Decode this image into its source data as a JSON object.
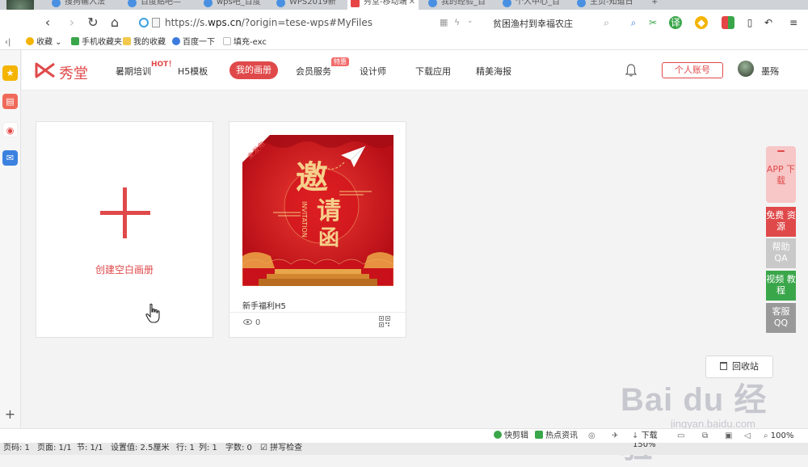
{
  "browser": {
    "tabs": [
      {
        "label": "搜狗输入法"
      },
      {
        "label": "百度贴吧—"
      },
      {
        "label": "wps吧_百度"
      },
      {
        "label": "WPS2019新"
      },
      {
        "label": "秀堂-移动端",
        "active": true
      },
      {
        "label": "我的经验_百"
      },
      {
        "label": "个人中心_百"
      },
      {
        "label": "主页-知道日"
      }
    ],
    "url_prefix": "https://s.",
    "url_host": "wps.cn",
    "url_rest": "/?origin=tese-wps#MyFiles",
    "search_text": "贫困渔村到幸福农庄"
  },
  "bookmarks": [
    {
      "label": "收藏",
      "color": "#f4b400"
    },
    {
      "label": "手机收藏夹",
      "color": "#3aa64a"
    },
    {
      "label": "我的收藏",
      "color": "#f2c94c"
    },
    {
      "label": "百度一下",
      "color": "#3b7be0"
    },
    {
      "label": "填充-exc",
      "color": "#cccccc"
    }
  ],
  "header": {
    "logo_text": "秀堂",
    "nav": {
      "summer": "暑期培训",
      "hot_badge": "HOT！",
      "h5": "H5模板",
      "albums": "我的画册",
      "member": "会员服务",
      "member_tag": "特惠",
      "designer": "设计师",
      "download": "下载应用",
      "poster": "精美海报"
    },
    "account_button": "个人账号",
    "user_name": "墨殇"
  },
  "content": {
    "create_label": "创建空白画册",
    "album": {
      "title": "新手福利H5",
      "views": "0",
      "status_ribbon": "未发布",
      "cover_text": [
        "邀",
        "请",
        "函"
      ],
      "cover_sub": "INVITATION"
    }
  },
  "float_panel": {
    "app": "APP 下载",
    "free": "免费 资源",
    "help": "帮助 QA",
    "video": "视频 教程",
    "qq": "客服 QQ"
  },
  "recycle_label": "回收站",
  "watermark": {
    "line1": "Bai du 经验",
    "line2": "jingyan.baidu.com"
  },
  "browser_status": {
    "clip": "快剪辑",
    "hotnews": "热点资讯",
    "download": "下载",
    "zoom": "100%"
  },
  "wps_status": {
    "page_count": "页码: 1",
    "pages": "页面: 1/1",
    "section": "节: 1/1",
    "setting": "设置值: 2.5厘米",
    "row": "行: 1",
    "col": "列: 1",
    "words": "字数: 0",
    "spell": "拼写检查",
    "zoom": "150%"
  },
  "colors": {
    "brand": "#e0494a",
    "green": "#3aa64a",
    "grey": "#999999"
  }
}
